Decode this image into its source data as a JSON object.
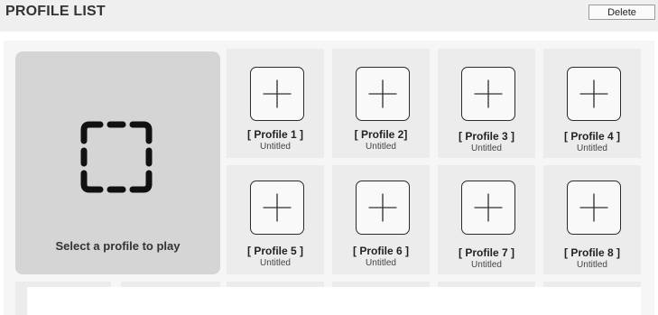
{
  "header": {
    "title": "PROFILE LIST",
    "delete_label": "Delete"
  },
  "select_panel": {
    "label": "Select a profile to play",
    "icon": "dashed-square-icon"
  },
  "profiles": [
    {
      "name": "[ Profile 1 ]",
      "subtitle": "Untitled",
      "icon": "plus-icon"
    },
    {
      "name": "[ Profile 2]",
      "subtitle": "Untitled",
      "icon": "plus-icon"
    },
    {
      "name": "[ Profile 3 ]",
      "subtitle": "Untitled",
      "icon": "plus-icon"
    },
    {
      "name": "[ Profile 4 ]",
      "subtitle": "Untitled",
      "icon": "plus-icon"
    },
    {
      "name": "[ Profile 5 ]",
      "subtitle": "Untitled",
      "icon": "plus-icon"
    },
    {
      "name": "[ Profile 6 ]",
      "subtitle": "Untitled",
      "icon": "plus-icon"
    },
    {
      "name": "[ Profile 7 ]",
      "subtitle": "Untitled",
      "icon": "plus-icon"
    },
    {
      "name": "[ Profile 8 ]",
      "subtitle": "Untitled",
      "icon": "plus-icon"
    }
  ],
  "colors": {
    "header_bg": "#efefef",
    "panel_bg": "#d5d5d5",
    "slot_bg": "#ececec"
  }
}
